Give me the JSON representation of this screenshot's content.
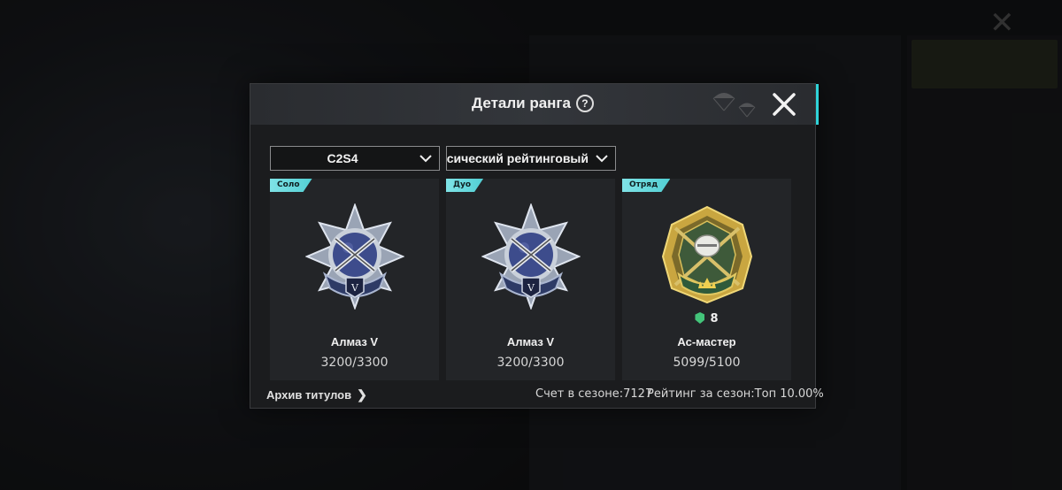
{
  "dialog": {
    "title": "Детали ранга",
    "help_icon": "?",
    "close_icon": "close-icon"
  },
  "filters": {
    "season": "C2S4",
    "mode": "Классический рейтинговый"
  },
  "cards": [
    {
      "tag": "Соло",
      "rank": "Алмаз V",
      "points": "3200/3300",
      "emblem": "diamond-emblem"
    },
    {
      "tag": "Дуо",
      "rank": "Алмаз V",
      "points": "3200/3300",
      "emblem": "diamond-emblem"
    },
    {
      "tag": "Отряд",
      "rank": "Ас-мастер",
      "points": "5099/5100",
      "level": "8",
      "emblem": "ace-master-emblem"
    }
  ],
  "footer": {
    "archive_label": "Архив титулов",
    "season_score": "Счет в сезоне:7127",
    "season_rating": "Рейтинг за сезон:Топ 10.00%"
  },
  "colors": {
    "accent": "#52cfd4",
    "card_bg": "#232528",
    "dialog_bg": "#1b1c1e"
  }
}
